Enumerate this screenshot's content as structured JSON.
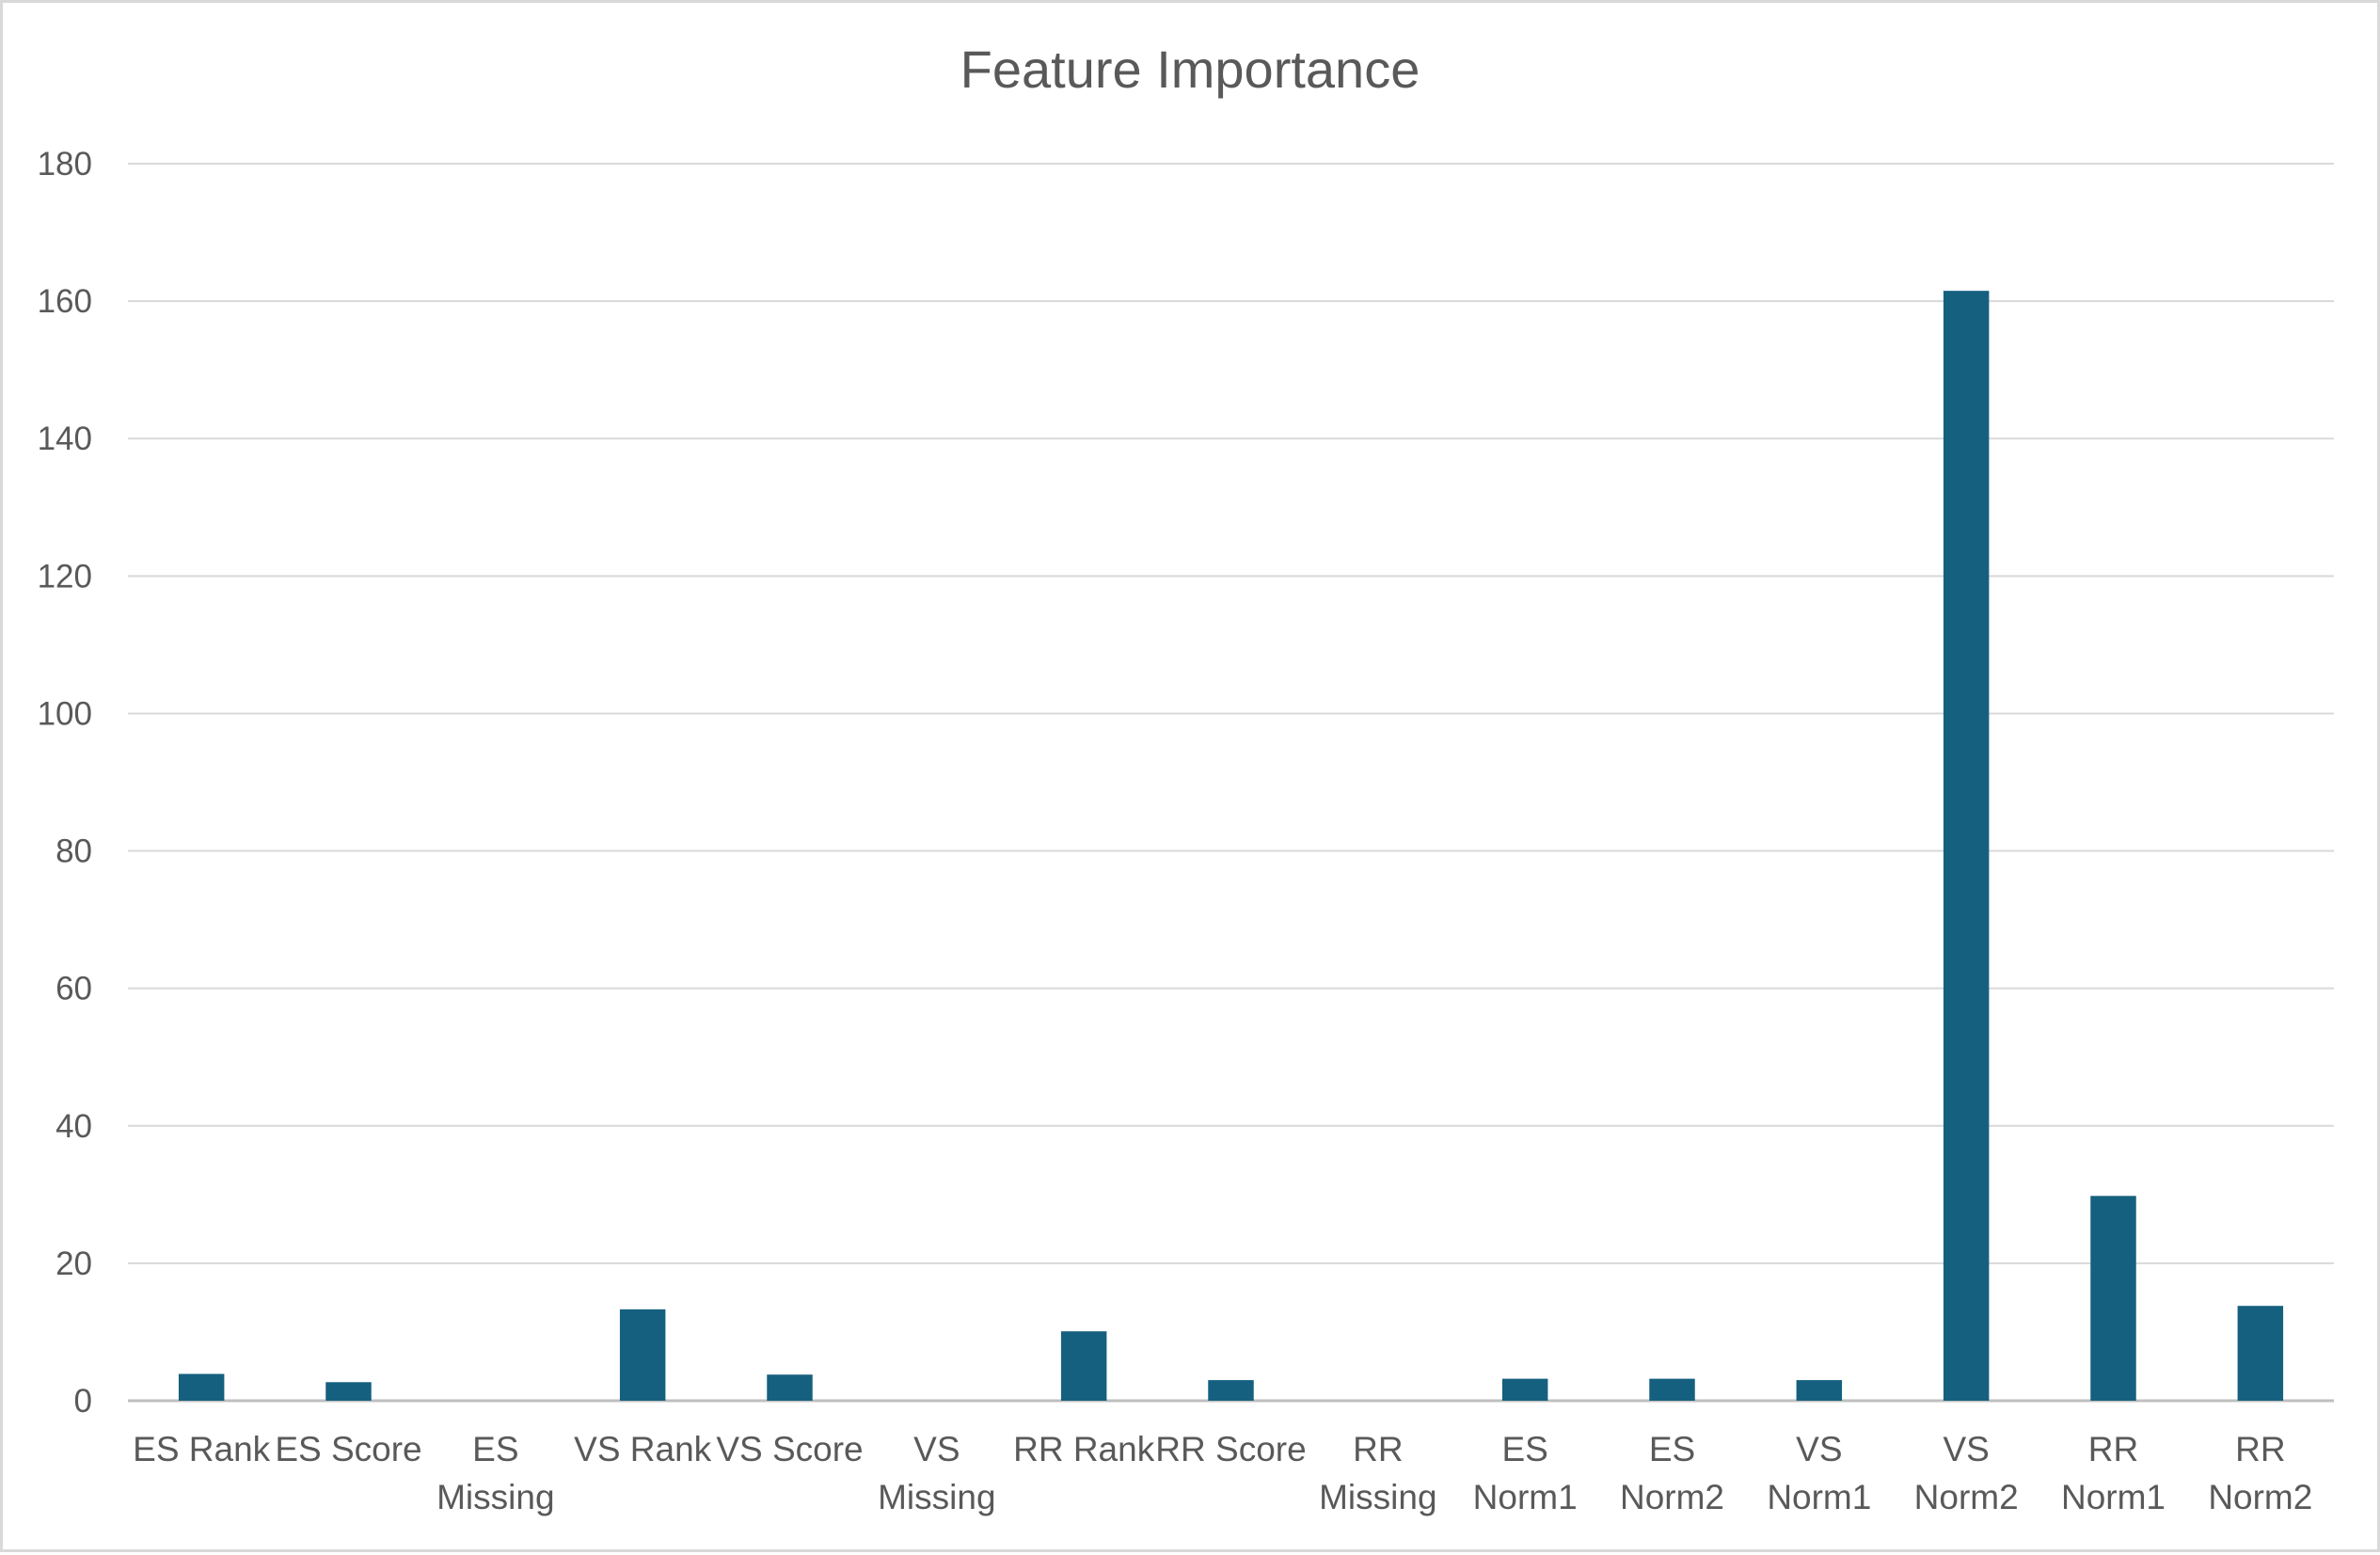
{
  "chart_data": {
    "type": "bar",
    "title": "Feature Importance",
    "xlabel": "",
    "ylabel": "",
    "ylim": [
      0,
      180
    ],
    "yticks": [
      0,
      20,
      40,
      60,
      80,
      100,
      120,
      140,
      160,
      180
    ],
    "grid": true,
    "legend": "none",
    "bar_color": "#15607f",
    "categories": [
      "ES Rank",
      "ES Score",
      "ES Missing",
      "VS Rank",
      "VS Score",
      "VS Missing",
      "RR Rank",
      "RR Score",
      "RR Missing",
      "ES Norm1",
      "ES Norm2",
      "VS Norm1",
      "VS Norm2",
      "RR Norm1",
      "RR Norm2"
    ],
    "category_label_lines": [
      [
        "ES Rank"
      ],
      [
        "ES Score"
      ],
      [
        "ES",
        "Missing"
      ],
      [
        "VS Rank"
      ],
      [
        "VS Score"
      ],
      [
        "VS",
        "Missing"
      ],
      [
        "RR Rank"
      ],
      [
        "RR Score"
      ],
      [
        "RR",
        "Missing"
      ],
      [
        "ES",
        "Norm1"
      ],
      [
        "ES",
        "Norm2"
      ],
      [
        "VS",
        "Norm1"
      ],
      [
        "VS",
        "Norm2"
      ],
      [
        "RR",
        "Norm1"
      ],
      [
        "RR",
        "Norm2"
      ]
    ],
    "values": [
      3.9,
      2.7,
      0,
      13.3,
      3.8,
      0,
      10.1,
      3.0,
      0,
      3.2,
      3.2,
      3.0,
      161.5,
      29.8,
      13.8
    ]
  }
}
